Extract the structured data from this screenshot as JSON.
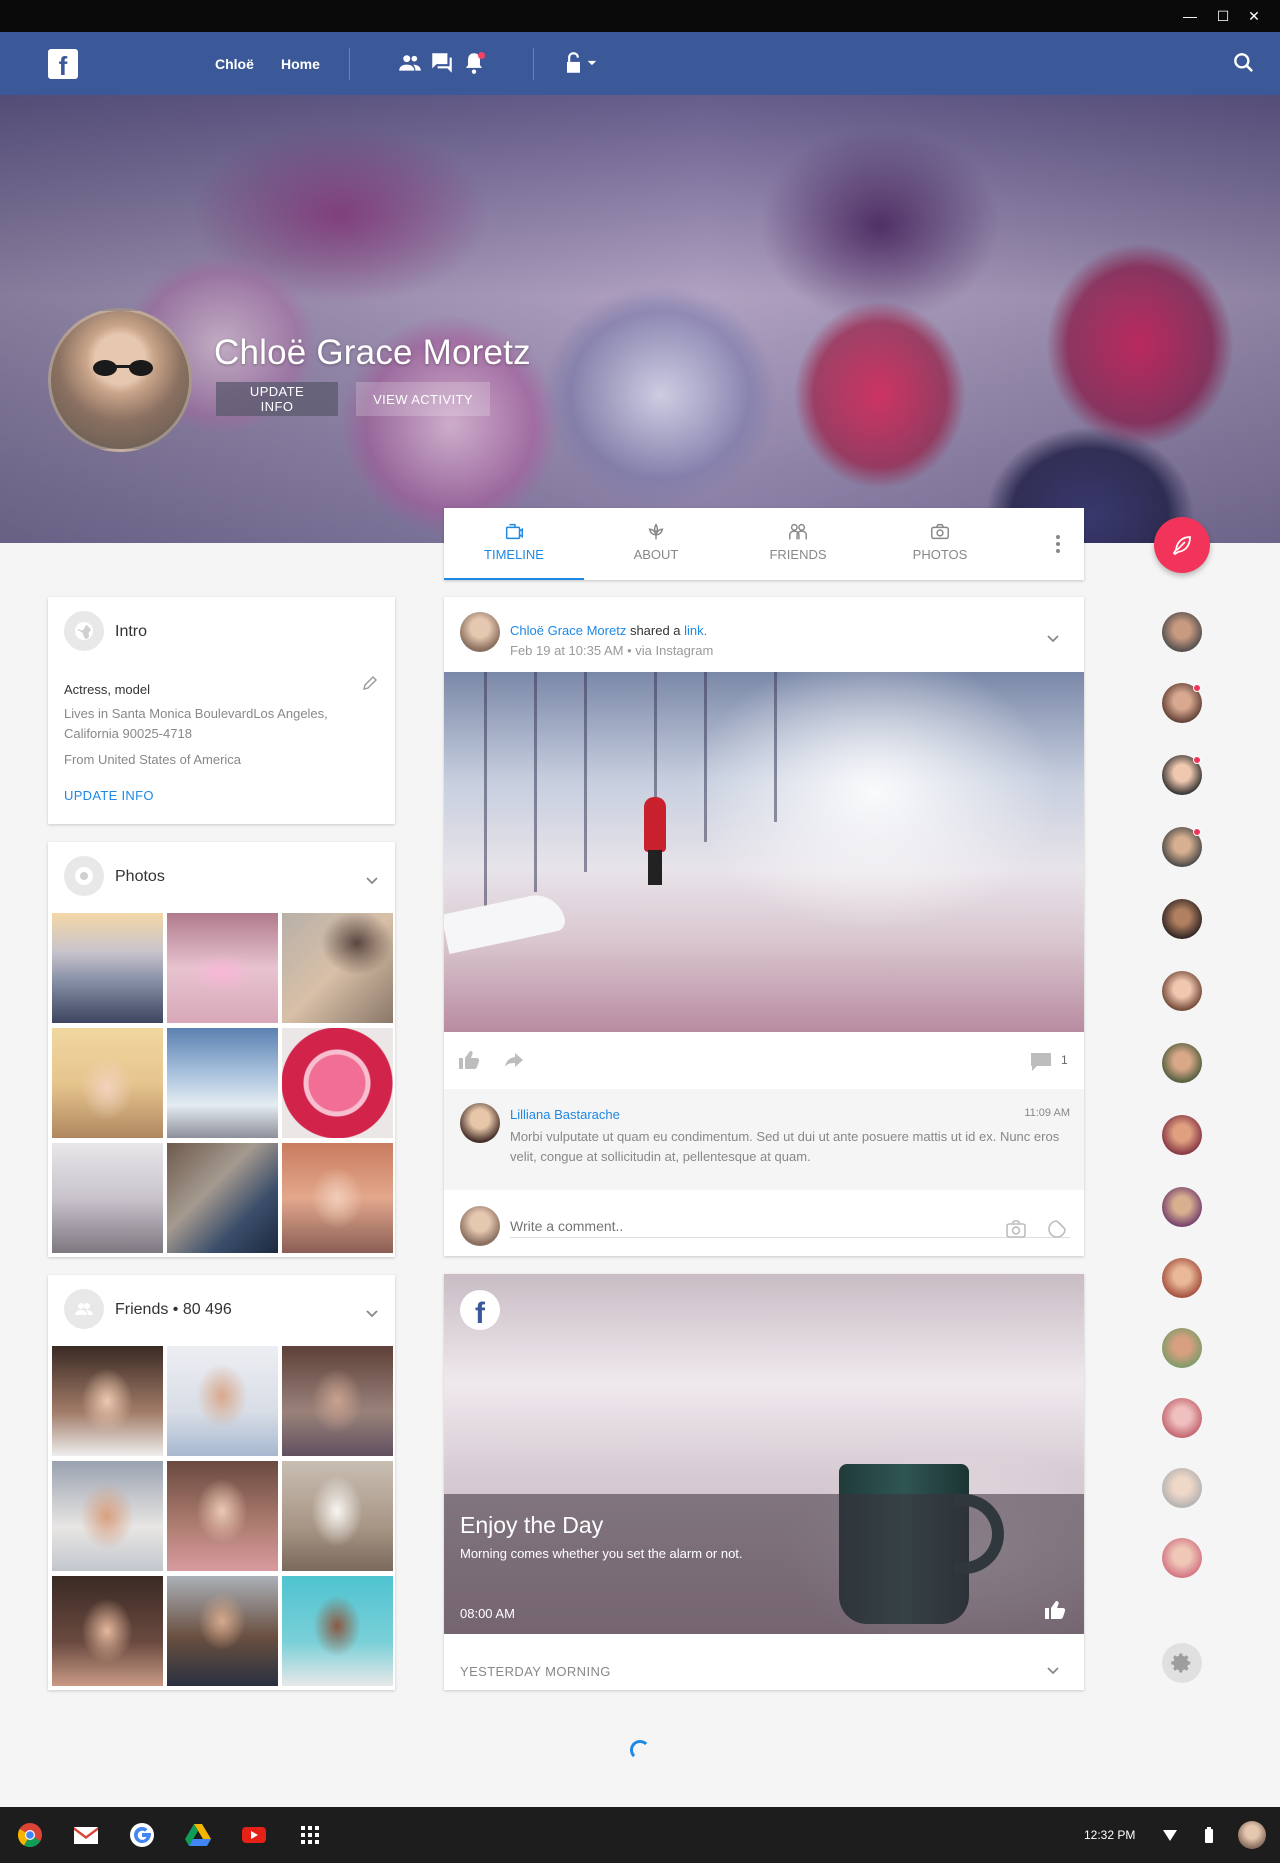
{
  "window": {
    "minimize": "—",
    "maximize": "☐",
    "close": "✕"
  },
  "header": {
    "logo": "f",
    "nav": [
      "Chloë",
      "Home"
    ],
    "icons": [
      "friends-icon",
      "messages-icon",
      "notifications-icon",
      "lock-icon",
      "search-icon"
    ]
  },
  "profile": {
    "name": "Chloë Grace Moretz",
    "update_info_label": "UPDATE INFO",
    "view_activity_label": "VIEW ACTIVITY"
  },
  "tabs": [
    {
      "label": "TIMELINE",
      "icon": "timeline-icon"
    },
    {
      "label": "ABOUT",
      "icon": "about-icon"
    },
    {
      "label": "FRIENDS",
      "icon": "friends-icon"
    },
    {
      "label": "PHOTOS",
      "icon": "camera-icon"
    }
  ],
  "intro": {
    "title": "Intro",
    "job": "Actress, model",
    "lives": "Lives in Santa Monica BoulevardLos Angeles, California 90025-4718",
    "from": "From United States of America",
    "update_label": "UPDATE INFO"
  },
  "photos": {
    "title": "Photos"
  },
  "friends": {
    "title": "Friends • 80 496"
  },
  "post": {
    "author": "Chloë Grace Moretz",
    "action": " shared a ",
    "link_text": "link.",
    "meta": "Feb 19 at 10:35 AM • via Instagram",
    "comment_count": "1",
    "comment": {
      "author": "Lilliana Bastarache",
      "time": "11:09 AM",
      "text": "Morbi vulputate ut quam eu condimentum. Sed ut dui ut ante posuere mattis ut id ex. Nunc eros velit, congue at sollicitudin at, pellentesque at quam."
    },
    "write_placeholder": "Write a comment.."
  },
  "story": {
    "title": "Enjoy the Day",
    "subtitle": "Morning comes whether you set the alarm or not.",
    "time": "08:00 AM",
    "footer": "YESTERDAY MORNING"
  },
  "taskbar": {
    "time": "12:32 PM"
  },
  "colors": {
    "brand": "#3b5998",
    "accent": "#1e88e5",
    "fab": "#f2345a"
  }
}
